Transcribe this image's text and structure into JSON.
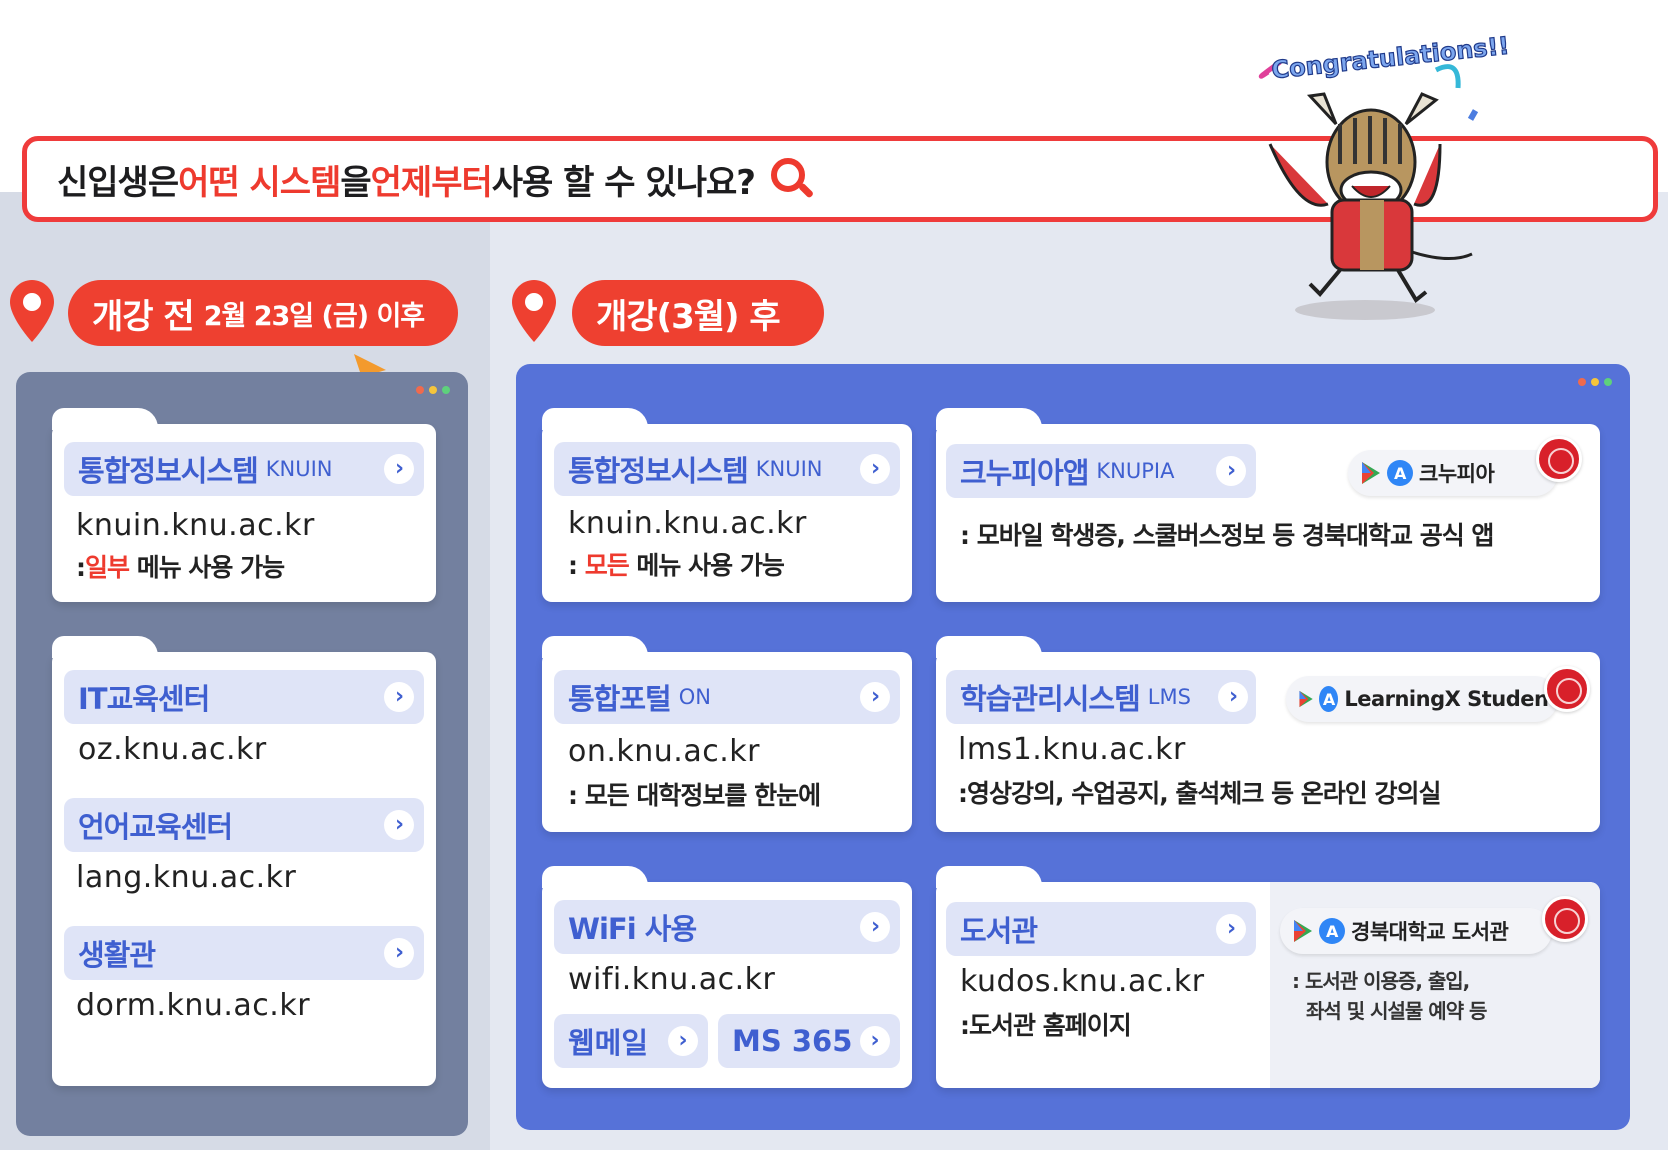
{
  "colors": {
    "accent_red": "#ee3a2e",
    "label_blue": "#3f5fd0",
    "panel_left": "#73809f",
    "panel_right": "#5672d8"
  },
  "header": {
    "q_part1": "신입생은 ",
    "q_part2": "어떤 시스템",
    "q_part3": "을 ",
    "q_part4": "언제부터",
    "q_part5": " 사용 할 수 있나요?"
  },
  "mascot": {
    "banner": "Congratulations!!"
  },
  "before": {
    "pill_main": "개강 전",
    "pill_date": "2월 23일 (금) 이후",
    "knuin": {
      "label": "통합정보시스템",
      "sub": "KNUIN",
      "url": "knuin.knu.ac.kr",
      "desc_a": ":",
      "desc_red": "일부",
      "desc_b": " 메뉴 사용 가능"
    },
    "it": {
      "label": "IT교육센터",
      "url": "oz.knu.ac.kr"
    },
    "lang": {
      "label": "언어교육센터",
      "url": "lang.knu.ac.kr"
    },
    "dorm": {
      "label": "생활관",
      "url": "dorm.knu.ac.kr"
    }
  },
  "after": {
    "pill_main": "개강(3월) 후",
    "knuin": {
      "label": "통합정보시스템",
      "sub": "KNUIN",
      "url": "knuin.knu.ac.kr",
      "desc_a": ": ",
      "desc_red": "모든",
      "desc_b": " 메뉴 사용 가능"
    },
    "knupia": {
      "label": "크누피아앱",
      "sub": "KNUPIA",
      "app": "크누피아",
      "desc": ": 모바일 학생증, 스쿨버스정보 등 경북대학교 공식 앱"
    },
    "on": {
      "label": "통합포털",
      "sub": "ON",
      "url": "on.knu.ac.kr",
      "desc": ": 모든 대학정보를 한눈에"
    },
    "lms": {
      "label": "학습관리시스템",
      "sub": "LMS",
      "app": "LearningX Student",
      "url": "lms1.knu.ac.kr",
      "desc": ":영상강의, 수업공지, 출석체크 등 온라인 강의실"
    },
    "wifi": {
      "label": "WiFi 사용",
      "url": "wifi.knu.ac.kr",
      "webmail": "웹메일",
      "ms365": "MS 365"
    },
    "library": {
      "label": "도서관",
      "url": "kudos.knu.ac.kr",
      "desc": ":도서관 홈페이지",
      "app": "경북대학교 도서관",
      "desc2_l1": ": 도서관 이용증, 출입,",
      "desc2_l2": "좌석 및 시설물 예약 등"
    }
  }
}
